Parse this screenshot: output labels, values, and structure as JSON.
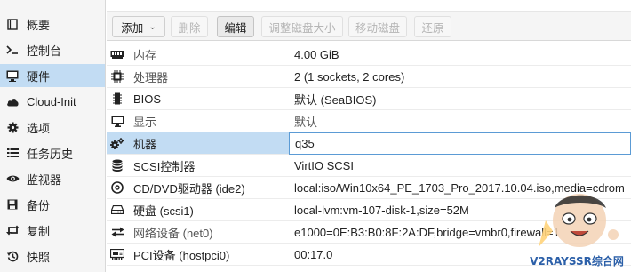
{
  "sidebar": {
    "items": [
      {
        "label": "概要",
        "icon": "book-icon"
      },
      {
        "label": "控制台",
        "icon": "terminal-icon"
      },
      {
        "label": "硬件",
        "icon": "desktop-icon",
        "active": true
      },
      {
        "label": "Cloud-Init",
        "icon": "cloud-icon"
      },
      {
        "label": "选项",
        "icon": "gear-icon"
      },
      {
        "label": "任务历史",
        "icon": "list-icon"
      },
      {
        "label": "监视器",
        "icon": "eye-icon"
      },
      {
        "label": "备份",
        "icon": "floppy-icon"
      },
      {
        "label": "复制",
        "icon": "retweet-icon"
      },
      {
        "label": "快照",
        "icon": "history-icon"
      }
    ]
  },
  "toolbar": {
    "add_label": "添加",
    "delete_label": "删除",
    "edit_label": "编辑",
    "resize_label": "调整磁盘大小",
    "move_label": "移动磁盘",
    "revert_label": "还原"
  },
  "hardware": {
    "rows": [
      {
        "key": "内存",
        "value": "4.00 GiB",
        "icon": "memory-icon",
        "muted": true
      },
      {
        "key": "处理器",
        "value": "2 (1 sockets, 2 cores)",
        "icon": "cpu-icon",
        "muted": true
      },
      {
        "key": "BIOS",
        "value": "默认 (SeaBIOS)",
        "icon": "microchip-icon",
        "muted": false
      },
      {
        "key": "显示",
        "value": "默认",
        "icon": "monitor-icon",
        "muted": true
      },
      {
        "key": "机器",
        "value": "q35",
        "icon": "cogs-icon",
        "muted": false,
        "selected": true
      },
      {
        "key": "SCSI控制器",
        "value": "VirtIO SCSI",
        "icon": "database-icon",
        "muted": false
      },
      {
        "key": "CD/DVD驱动器 (ide2)",
        "value": "local:iso/Win10x64_PE_1703_Pro_2017.10.04.iso,media=cdrom",
        "icon": "cdrom-icon",
        "muted": false
      },
      {
        "key": "硬盘 (scsi1)",
        "value": "local-lvm:vm-107-disk-1,size=52M",
        "icon": "hdd-icon",
        "muted": false
      },
      {
        "key": "网络设备 (net0)",
        "value": "e1000=0E:B3:B0:8F:2A:DF,bridge=vmbr0,firewall=1",
        "icon": "exchange-icon",
        "muted": true
      },
      {
        "key": "PCI设备 (hostpci0)",
        "value": "00:17.0",
        "icon": "pci-card-icon",
        "muted": false
      }
    ]
  },
  "watermark": {
    "text": "V2RAYSSR综合网"
  },
  "colors": {
    "selection": "#c2dcf3",
    "focus_border": "#5b9bd5"
  }
}
